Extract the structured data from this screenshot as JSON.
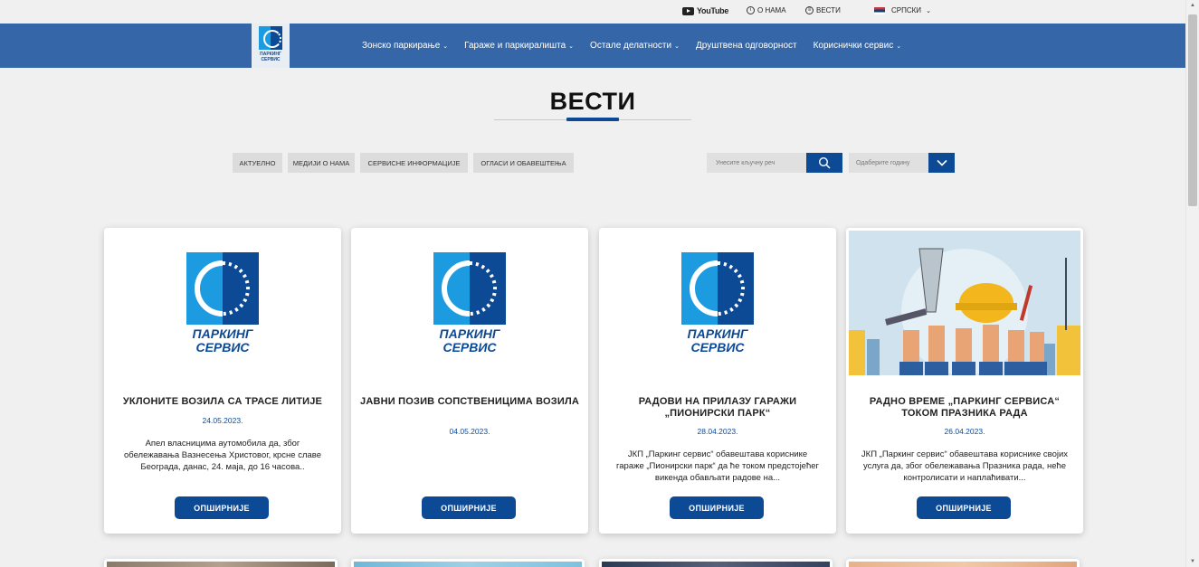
{
  "topbar": {
    "youtube_label": "YouTube",
    "about_label": "О НАМА",
    "news_label": "ВЕСТИ",
    "language_label": "СРПСКИ"
  },
  "header": {
    "logo_text_line1": "ПАРКИНГ",
    "logo_text_line2": "СЕРВИС",
    "nav": [
      {
        "label": "Зонско паркирање",
        "dropdown": true
      },
      {
        "label": "Гараже и паркиралишта",
        "dropdown": true
      },
      {
        "label": "Остале делатности",
        "dropdown": true
      },
      {
        "label": "Друштвена одговорност",
        "dropdown": false
      },
      {
        "label": "Кориснички сервис",
        "dropdown": true
      }
    ]
  },
  "page": {
    "title": "ВЕСТИ"
  },
  "filters": {
    "categories": [
      "АКТУЕЛНО",
      "МЕДИЈИ О НАМА",
      "СЕРВИСНЕ ИНФОРМАЦИЈЕ",
      "ОГЛАСИ И ОБАВЕШТЕЊА"
    ],
    "search_placeholder": "Унесите кључну реч",
    "year_placeholder": "Одаберите годину"
  },
  "cards": [
    {
      "title": "УКЛОНИТЕ ВОЗИЛА СА ТРАСЕ ЛИТИЈЕ",
      "date": "24.05.2023.",
      "excerpt": "Апел власницима аутомобила да, због обележавања Вазнесења Христовог, крсне славе Београда, данас, 24. маја, до 16 часова..",
      "button": "ОПШИРНИЈЕ",
      "image": "logo"
    },
    {
      "title": "ЈАВНИ ПОЗИВ СОПСТВЕНИЦИМА ВОЗИЛА",
      "date": "04.05.2023.",
      "excerpt": "",
      "button": "ОПШИРНИЈЕ",
      "image": "logo"
    },
    {
      "title": "РАДОВИ НА ПРИЛАЗУ ГАРАЖИ „ПИОНИРСКИ ПАРК“",
      "date": "28.04.2023.",
      "excerpt": "ЈКП „Паркинг сервис“ обавештава кориснике гараже „Пионирски парк“ да ће током предстојећег викенда обављати радове на...",
      "button": "ОПШИРНИЈЕ",
      "image": "logo"
    },
    {
      "title": "РАДНО ВРЕМЕ „ПАРКИНГ СЕРВИСА“ ТОКОМ ПРАЗНИКА РАДА",
      "date": "26.04.2023.",
      "excerpt": "ЈКП „Паркинг сервис“ обавештава кориснике својих услуга да, због обележавања Празника рада, неће контролисати и наплаћивати...",
      "button": "ОПШИРНИЈЕ",
      "image": "workers-illustration"
    }
  ],
  "colors": {
    "nav_bg": "#3466a8",
    "accent": "#0d4a96",
    "logo_light": "#1d9be0"
  }
}
